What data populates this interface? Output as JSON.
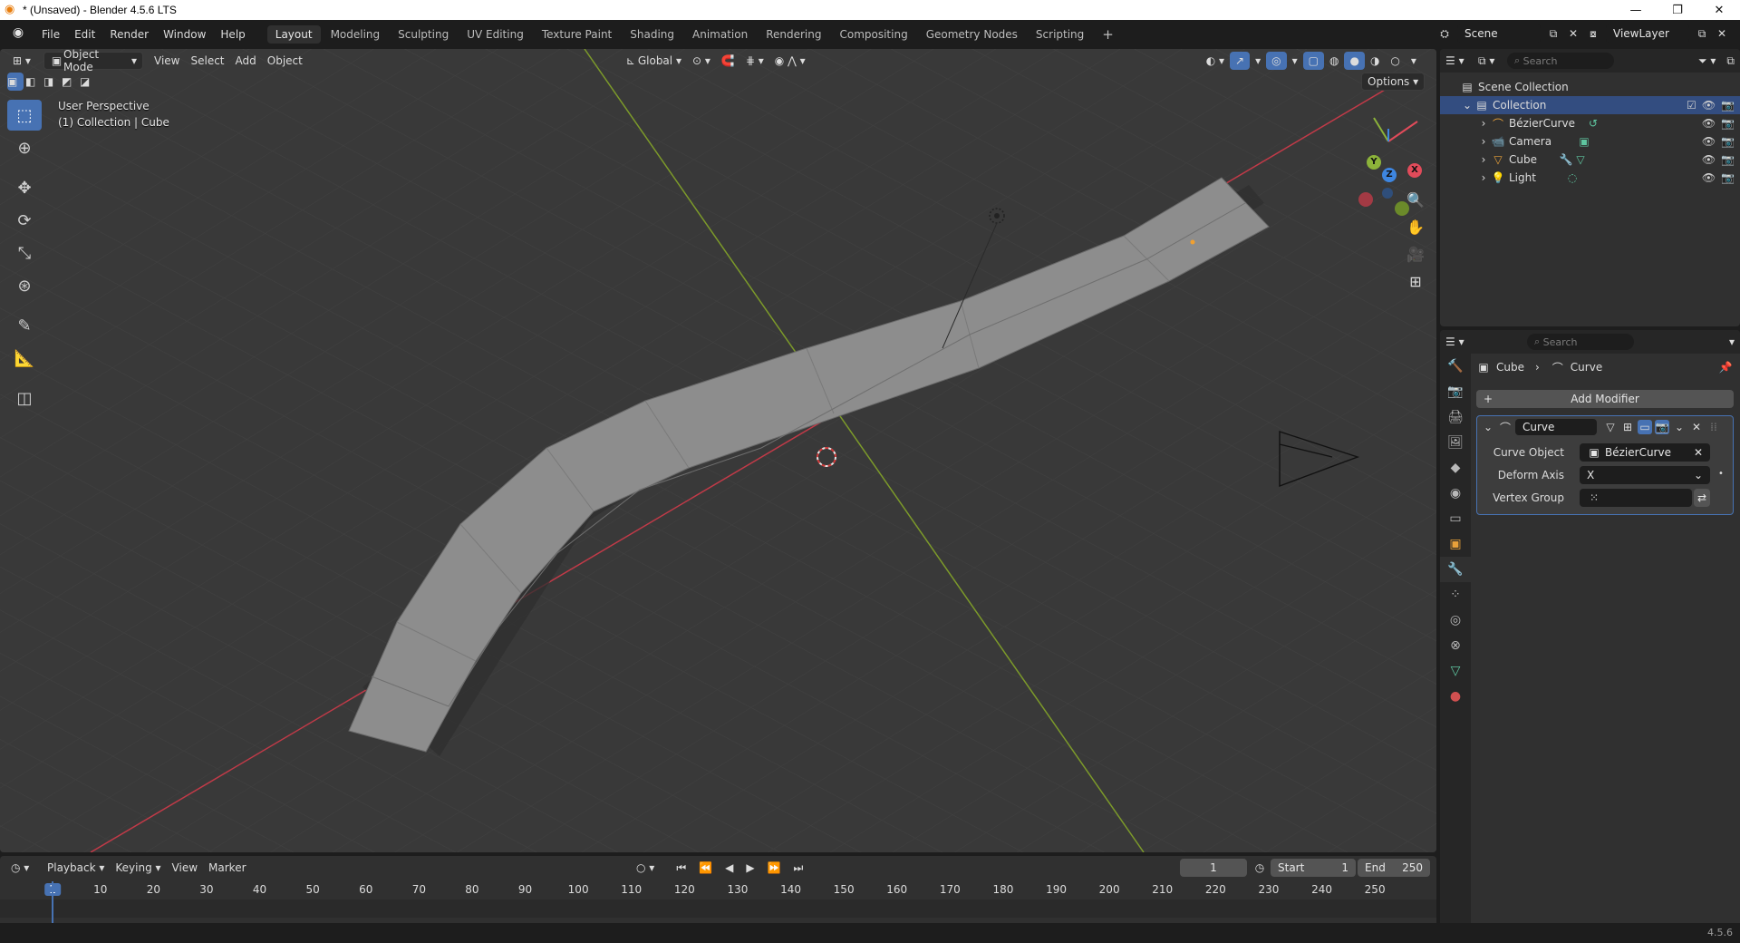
{
  "window": {
    "title": "* (Unsaved) - Blender 4.5.6 LTS"
  },
  "menu": [
    "File",
    "Edit",
    "Render",
    "Window",
    "Help"
  ],
  "workspaces": [
    {
      "label": "Layout",
      "active": true
    },
    {
      "label": "Modeling",
      "active": false
    },
    {
      "label": "Sculpting",
      "active": false
    },
    {
      "label": "UV Editing",
      "active": false
    },
    {
      "label": "Texture Paint",
      "active": false
    },
    {
      "label": "Shading",
      "active": false
    },
    {
      "label": "Animation",
      "active": false
    },
    {
      "label": "Rendering",
      "active": false
    },
    {
      "label": "Compositing",
      "active": false
    },
    {
      "label": "Geometry Nodes",
      "active": false
    },
    {
      "label": "Scripting",
      "active": false
    }
  ],
  "scene": {
    "name": "Scene",
    "view_layer": "ViewLayer"
  },
  "viewport": {
    "mode": "Object Mode",
    "menus": [
      "View",
      "Select",
      "Add",
      "Object"
    ],
    "orientation": "Global",
    "options_label": "Options",
    "info_line1": "User Perspective",
    "info_line2": "(1) Collection | Cube",
    "gizmo": {
      "x": "X",
      "y": "Y",
      "z": "Z"
    }
  },
  "outliner": {
    "search_placeholder": "Search",
    "root": "Scene Collection",
    "collection": "Collection",
    "items": [
      {
        "label": "BézierCurve",
        "icon": "curve-icon",
        "extra": "curve-data-icon",
        "color": "#e8a13a"
      },
      {
        "label": "Camera",
        "icon": "camera-icon",
        "extra": "camera-data-icon",
        "color": "#6f9fcb"
      },
      {
        "label": "Cube",
        "icon": "mesh-icon",
        "extra": "modifier-and-mesh-icons",
        "color": "#e8a13a"
      },
      {
        "label": "Light",
        "icon": "light-icon",
        "extra": "light-data-icon",
        "color": "#e8a13a"
      }
    ]
  },
  "properties": {
    "search_placeholder": "Search",
    "breadcrumb_object": "Cube",
    "breadcrumb_modifier": "Curve",
    "add_modifier": "Add Modifier",
    "modifier": {
      "name": "Curve",
      "curve_object_label": "Curve Object",
      "curve_object_value": "BézierCurve",
      "deform_axis_label": "Deform Axis",
      "deform_axis_value": "X",
      "vertex_group_label": "Vertex Group"
    }
  },
  "timeline": {
    "menus": [
      "Playback",
      "Keying",
      "View",
      "Marker"
    ],
    "current_frame": "1",
    "start_label": "Start",
    "start_value": "1",
    "end_label": "End",
    "end_value": "250",
    "ruler_labels": [
      "1",
      "10",
      "20",
      "30",
      "40",
      "50",
      "60",
      "70",
      "80",
      "90",
      "100",
      "110",
      "120",
      "130",
      "140",
      "150",
      "160",
      "170",
      "180",
      "190",
      "200",
      "210",
      "220",
      "230",
      "240",
      "250"
    ]
  },
  "status": {
    "version": "4.5.6"
  }
}
